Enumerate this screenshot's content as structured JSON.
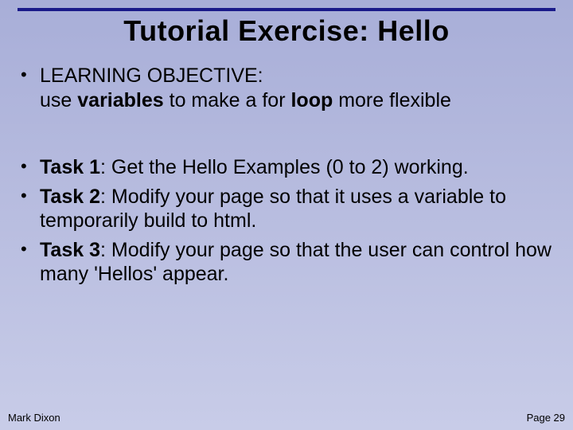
{
  "title": "Tutorial Exercise: Hello",
  "objective": {
    "label": "LEARNING OBJECTIVE:",
    "pre": "use ",
    "bold1": "variables",
    "mid": " to make a for ",
    "bold2": "loop",
    "post": " more flexible"
  },
  "tasks": [
    {
      "label": "Task 1",
      "text": ": Get the Hello Examples (0 to 2) working."
    },
    {
      "label": "Task 2",
      "text": ": Modify your page so that it uses a variable to temporarily build to html."
    },
    {
      "label": "Task 3",
      "text": ": Modify your page so that the user can control how many 'Hellos' appear."
    }
  ],
  "footer": {
    "author": "Mark Dixon",
    "page": "Page 29"
  }
}
